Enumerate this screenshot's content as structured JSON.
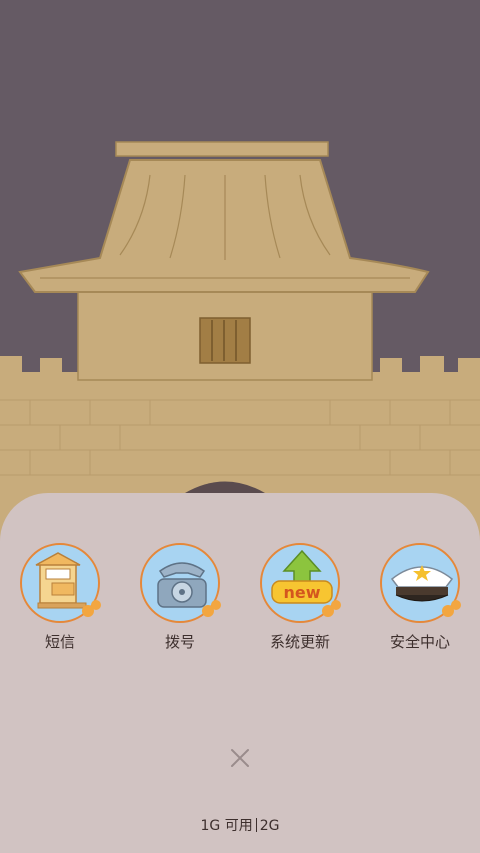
{
  "wallpaper": {
    "colors": {
      "sky": "#655A64",
      "building": "#C5A979",
      "wall": "#C5A979",
      "outline": "#9C7F52"
    }
  },
  "sheet": {
    "background": "#D1C3C2",
    "apps": [
      {
        "label": "短信",
        "icon": "mailbox-icon"
      },
      {
        "label": "拨号",
        "icon": "telephone-icon"
      },
      {
        "label": "系统更新",
        "icon": "new-arrow-icon"
      },
      {
        "label": "安全中心",
        "icon": "police-cap-icon"
      }
    ],
    "close_icon": "close-icon",
    "storage": {
      "left": "1G 可用",
      "right": "2G"
    }
  }
}
